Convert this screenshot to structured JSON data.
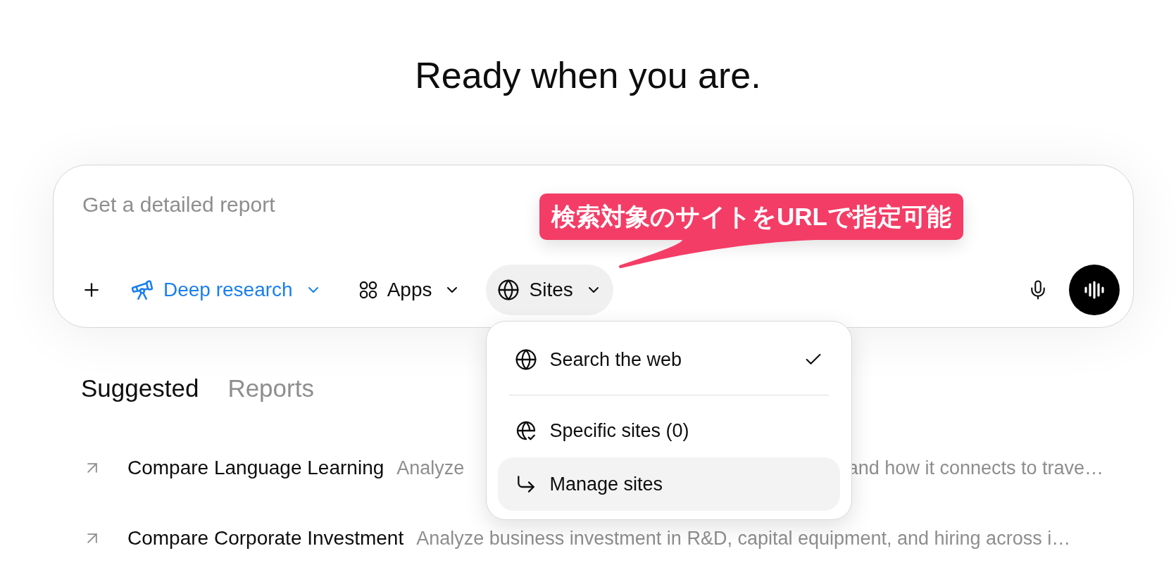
{
  "heading": "Ready when you are.",
  "composer": {
    "placeholder": "Get a detailed report",
    "tools": [
      {
        "kind": "mode",
        "label": "Deep research",
        "active": true,
        "expanded": false
      },
      {
        "kind": "apps",
        "label": "Apps",
        "active": false,
        "expanded": false
      },
      {
        "kind": "sites",
        "label": "Sites",
        "active": false,
        "expanded": true,
        "menu": {
          "sections": [
            {
              "items": [
                {
                  "kind": "option",
                  "label": "Search the web",
                  "checked": true,
                  "highlighted": false
                }
              ]
            },
            {
              "items": [
                {
                  "kind": "option",
                  "label": "Specific sites (0)",
                  "checked": false,
                  "highlighted": false
                },
                {
                  "kind": "action",
                  "label": "Manage sites",
                  "highlighted": true
                }
              ]
            }
          ]
        }
      }
    ]
  },
  "callout": {
    "text": "検索対象のサイトをURLで指定可能"
  },
  "tabs": [
    {
      "label": "Suggested",
      "selected": true
    },
    {
      "label": "Reports",
      "selected": false
    }
  ],
  "suggestions": [
    {
      "title": "Compare Language Learning",
      "description": [
        "Analyze",
        "and how it connects to trave…"
      ]
    },
    {
      "title": "Compare Corporate Investment",
      "description": [
        "Analyze business investment in R&D, capital equipment, and hiring across i…"
      ]
    }
  ]
}
